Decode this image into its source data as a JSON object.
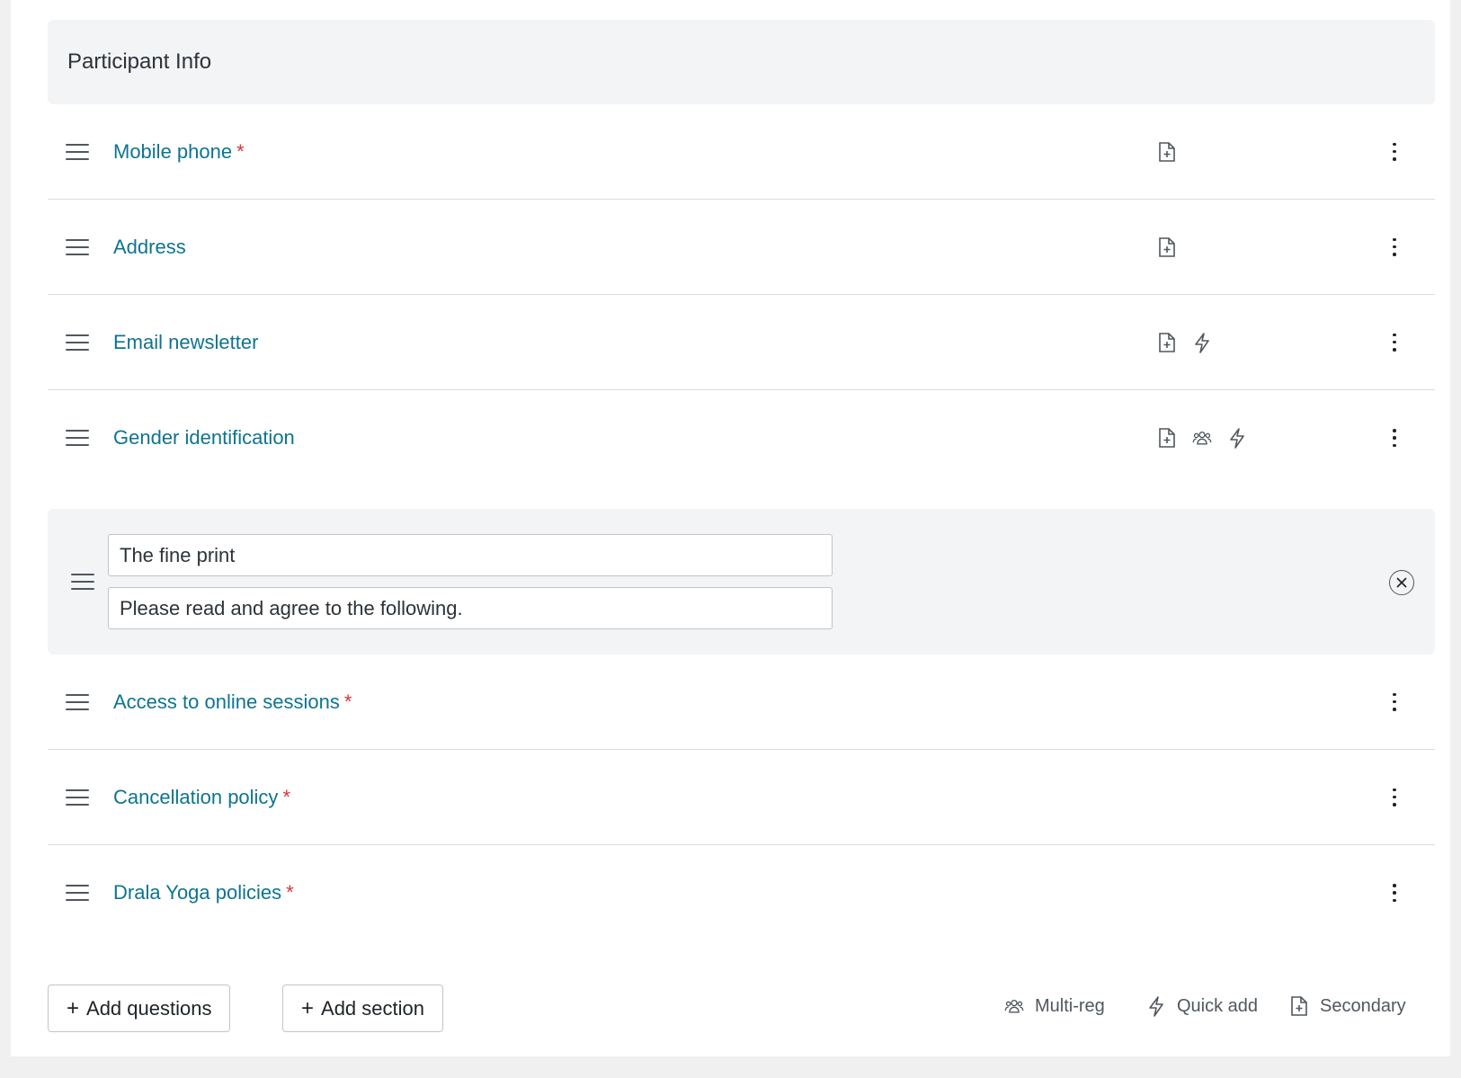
{
  "section": {
    "title": "Participant Info"
  },
  "rows_top": [
    {
      "label": "Mobile phone",
      "required": "*",
      "icons": [
        "secondary-icon"
      ]
    },
    {
      "label": "Address",
      "required": "",
      "icons": [
        "secondary-icon"
      ]
    },
    {
      "label": "Email newsletter",
      "required": "",
      "icons": [
        "secondary-icon",
        "quick-add-icon"
      ]
    },
    {
      "label": "Gender identification",
      "required": "",
      "icons": [
        "secondary-icon",
        "multi-reg-icon",
        "quick-add-icon"
      ]
    }
  ],
  "section_edit": {
    "title_value": "The fine print",
    "description_value": "Please read and agree to the following."
  },
  "rows_bottom": [
    {
      "label": "Access to online sessions",
      "required": "*"
    },
    {
      "label": "Cancellation policy",
      "required": "*"
    },
    {
      "label": "Drala Yoga policies",
      "required": "*"
    }
  ],
  "actions": {
    "add_questions": "Add questions",
    "add_section": "Add section",
    "plus": "+"
  },
  "legend": {
    "multi_reg": "Multi-reg",
    "quick_add": "Quick add",
    "secondary": "Secondary"
  },
  "colors": {
    "link": "#0e7490",
    "required": "#d63638",
    "panel": "#f3f4f6"
  }
}
